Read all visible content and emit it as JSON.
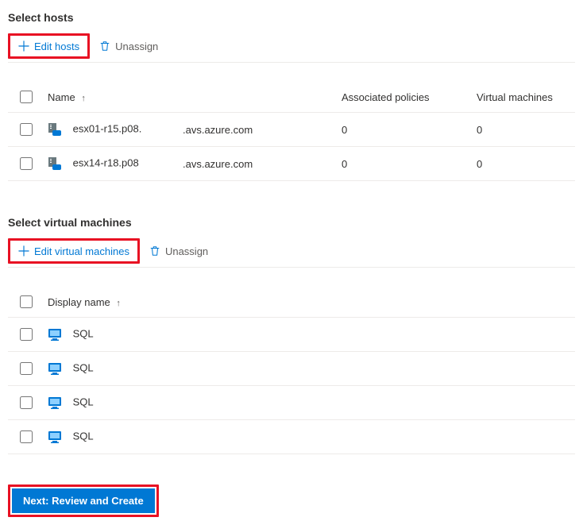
{
  "hosts_section": {
    "title": "Select hosts",
    "edit_label": "Edit hosts",
    "unassign_label": "Unassign",
    "columns": {
      "name": "Name",
      "assoc": "Associated policies",
      "vms": "Virtual machines"
    },
    "rows": [
      {
        "name": "esx01-r15.p08.",
        "domain": ".avs.azure.com",
        "assoc": "0",
        "vms": "0"
      },
      {
        "name": "esx14-r18.p08",
        "domain": ".avs.azure.com",
        "assoc": "0",
        "vms": "0"
      }
    ]
  },
  "vms_section": {
    "title": "Select virtual machines",
    "edit_label": "Edit virtual machines",
    "unassign_label": "Unassign",
    "columns": {
      "display_name": "Display name"
    },
    "rows": [
      {
        "display_name": "SQL"
      },
      {
        "display_name": "SQL"
      },
      {
        "display_name": "SQL"
      },
      {
        "display_name": "SQL"
      }
    ]
  },
  "footer": {
    "next_label": "Next: Review and Create"
  }
}
